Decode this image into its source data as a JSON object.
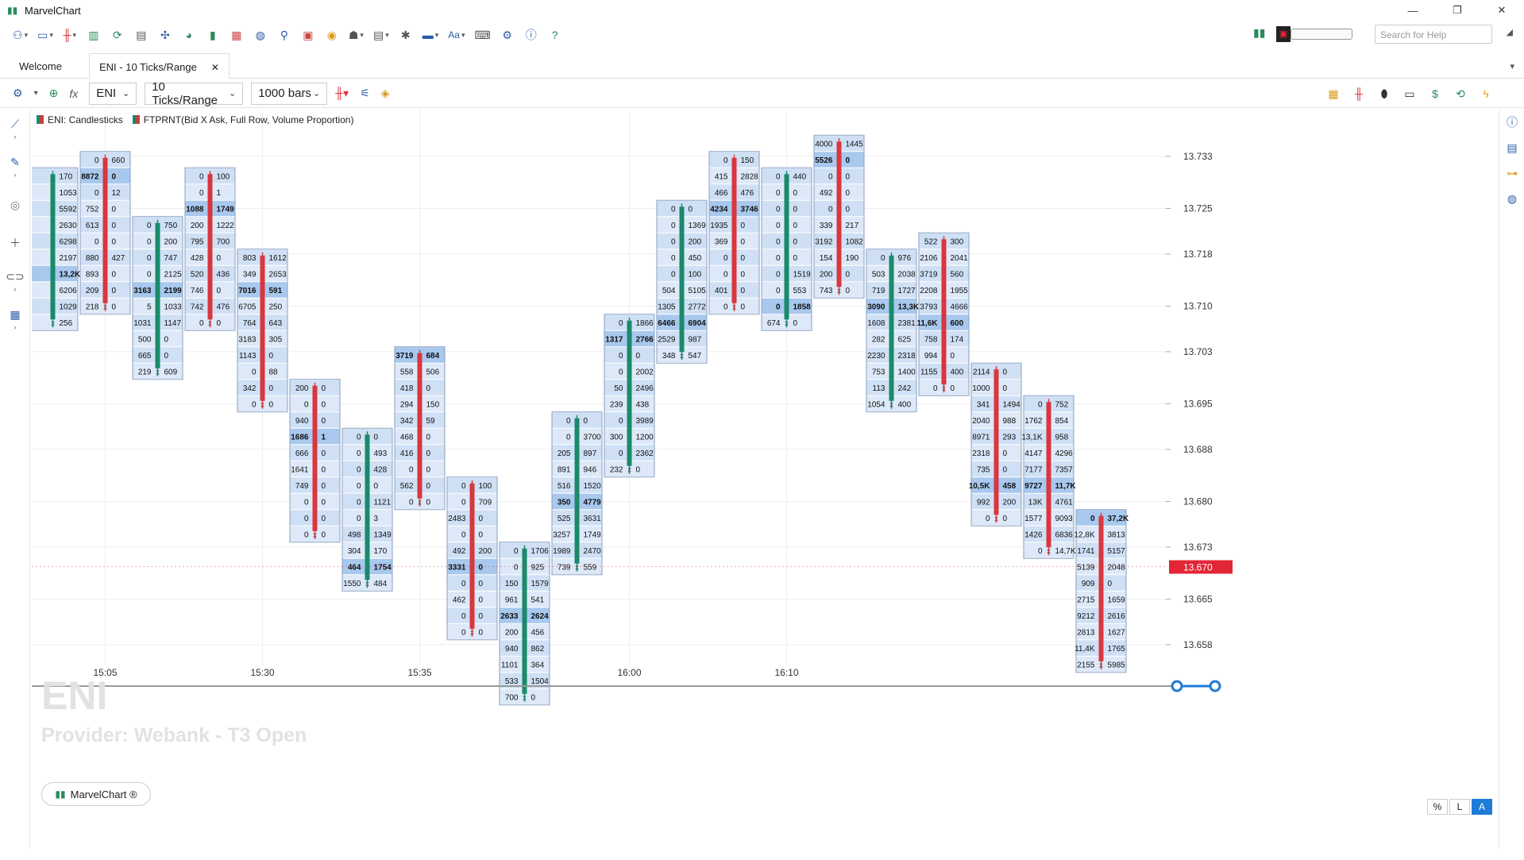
{
  "window": {
    "title": "MarvelChart",
    "buttons": [
      "—",
      "❐",
      "✕"
    ]
  },
  "toolbar": {
    "search_placeholder": "Search for Help"
  },
  "tabs": [
    {
      "label": "Welcome"
    },
    {
      "label": "ENI - 10 Ticks/Range",
      "close": "✕"
    }
  ],
  "chart_toolbar": {
    "symbol": "ENI",
    "timeframe": "10 Ticks/Range",
    "bars": "1000 bars"
  },
  "legend": {
    "series1": "ENI: Candlesticks",
    "series2": "FTPRNT(Bid X Ask, Full Row, Volume Proportion)"
  },
  "watermark": {
    "symbol": "ENI",
    "provider": "Provider: Webank - T3 Open"
  },
  "brand_button": "MarvelChart ®",
  "scale_buttons": [
    "%",
    "L",
    "A"
  ],
  "colors": {
    "bull": "#1a8a6a",
    "bear": "#d9363e",
    "cell": "#cfe0f5",
    "cell_alt": "#dde9f8",
    "poc": "#a8c8ee",
    "last": "#e32636"
  },
  "chart_data": {
    "type": "footprint",
    "symbol": "ENI",
    "tick_size": 0.0025,
    "price_axis": {
      "labels": [
        "13.733",
        "13.725",
        "13.718",
        "13.710",
        "13.703",
        "13.695",
        "13.688",
        "13.680",
        "13.673",
        "13.665",
        "13.658"
      ]
    },
    "last_price": "13.670",
    "time_labels": [
      "15:05",
      "15:30",
      "15:35",
      "16:00",
      "16:10"
    ],
    "bars": [
      {
        "dir": "bull",
        "top": 13.73,
        "rows": [
          [
            "",
            "170"
          ],
          [
            "",
            "1053"
          ],
          [
            "",
            "5592"
          ],
          [
            "",
            "2630"
          ],
          [
            "",
            "6298"
          ],
          [
            "",
            "2197"
          ],
          [
            "",
            "13,2K"
          ],
          [
            "",
            "6206"
          ],
          [
            "",
            "1029"
          ],
          [
            "",
            "256"
          ]
        ]
      },
      {
        "dir": "bear",
        "top": 13.7325,
        "rows": [
          [
            "0",
            "660"
          ],
          [
            "8872",
            "0"
          ],
          [
            "0",
            "12"
          ],
          [
            "752",
            "0"
          ],
          [
            "613",
            "0"
          ],
          [
            "0",
            "0"
          ],
          [
            "880",
            "427"
          ],
          [
            "893",
            "0"
          ],
          [
            "209",
            "0"
          ],
          [
            "218",
            "0"
          ]
        ]
      },
      {
        "dir": "bull",
        "top": 13.7225,
        "rows": [
          [
            "0",
            "750"
          ],
          [
            "0",
            "200"
          ],
          [
            "0",
            "747"
          ],
          [
            "0",
            "2125"
          ],
          [
            "3163",
            "2199"
          ],
          [
            "5",
            "1033"
          ],
          [
            "1031",
            "1147"
          ],
          [
            "500",
            "0"
          ],
          [
            "665",
            "0"
          ],
          [
            "219",
            "609"
          ]
        ]
      },
      {
        "dir": "bear",
        "top": 13.73,
        "rows": [
          [
            "0",
            "100"
          ],
          [
            "0",
            "1"
          ],
          [
            "1088",
            "1749"
          ],
          [
            "200",
            "1222"
          ],
          [
            "795",
            "700"
          ],
          [
            "428",
            "0"
          ],
          [
            "520",
            "436"
          ],
          [
            "746",
            "0"
          ],
          [
            "742",
            "476"
          ],
          [
            "0",
            "0"
          ]
        ]
      },
      {
        "dir": "bear",
        "top": 13.7175,
        "rows": [
          [
            "803",
            "1612"
          ],
          [
            "349",
            "2653"
          ],
          [
            "7016",
            "591"
          ],
          [
            "6705",
            "250"
          ],
          [
            "764",
            "643"
          ],
          [
            "3183",
            "305"
          ],
          [
            "1143",
            "0"
          ],
          [
            "0",
            "88"
          ],
          [
            "342",
            "0"
          ],
          [
            "0",
            "0"
          ]
        ]
      },
      {
        "dir": "bear",
        "top": 13.6975,
        "rows": [
          [
            "200",
            "0"
          ],
          [
            "0",
            "0"
          ],
          [
            "940",
            "0"
          ],
          [
            "1686",
            "1"
          ],
          [
            "666",
            "0"
          ],
          [
            "1641",
            "0"
          ],
          [
            "749",
            "0"
          ],
          [
            "0",
            "0"
          ],
          [
            "0",
            "0"
          ],
          [
            "0",
            "0"
          ]
        ]
      },
      {
        "dir": "bull",
        "top": 13.69,
        "rows": [
          [
            "0",
            "0"
          ],
          [
            "0",
            "493"
          ],
          [
            "0",
            "428"
          ],
          [
            "0",
            "0"
          ],
          [
            "0",
            "1121"
          ],
          [
            "0",
            "3"
          ],
          [
            "498",
            "1349"
          ],
          [
            "304",
            "170"
          ],
          [
            "464",
            "1754"
          ],
          [
            "1550",
            "484"
          ]
        ]
      },
      {
        "dir": "bear",
        "top": 13.7025,
        "rows": [
          [
            "3719",
            "684"
          ],
          [
            "558",
            "506"
          ],
          [
            "418",
            "0"
          ],
          [
            "294",
            "150"
          ],
          [
            "342",
            "59"
          ],
          [
            "468",
            "0"
          ],
          [
            "416",
            "0"
          ],
          [
            "0",
            "0"
          ],
          [
            "562",
            "0"
          ],
          [
            "0",
            "0"
          ]
        ]
      },
      {
        "dir": "bear",
        "top": 13.6825,
        "rows": [
          [
            "0",
            "100"
          ],
          [
            "0",
            "709"
          ],
          [
            "2483",
            "0"
          ],
          [
            "0",
            "0"
          ],
          [
            "492",
            "200"
          ],
          [
            "3331",
            "0"
          ],
          [
            "0",
            "0"
          ],
          [
            "462",
            "0"
          ],
          [
            "0",
            "0"
          ],
          [
            "0",
            "0"
          ]
        ]
      },
      {
        "dir": "bull",
        "top": 13.6725,
        "rows": [
          [
            "0",
            "1706"
          ],
          [
            "0",
            "925"
          ],
          [
            "150",
            "1579"
          ],
          [
            "961",
            "541"
          ],
          [
            "2633",
            "2624"
          ],
          [
            "200",
            "456"
          ],
          [
            "940",
            "862"
          ],
          [
            "1101",
            "364"
          ],
          [
            "533",
            "1504"
          ],
          [
            "700",
            "0"
          ]
        ]
      },
      {
        "dir": "bull",
        "top": 13.6925,
        "rows": [
          [
            "0",
            "0"
          ],
          [
            "0",
            "3700"
          ],
          [
            "205",
            "897"
          ],
          [
            "891",
            "946"
          ],
          [
            "516",
            "1520"
          ],
          [
            "350",
            "4779"
          ],
          [
            "525",
            "3631"
          ],
          [
            "3257",
            "1749"
          ],
          [
            "1989",
            "2470"
          ],
          [
            "739",
            "559"
          ]
        ]
      },
      {
        "dir": "bull",
        "top": 13.7075,
        "rows": [
          [
            "0",
            "1866"
          ],
          [
            "1317",
            "2766"
          ],
          [
            "0",
            "0"
          ],
          [
            "0",
            "2002"
          ],
          [
            "50",
            "2496"
          ],
          [
            "239",
            "438"
          ],
          [
            "0",
            "3989"
          ],
          [
            "300",
            "1200"
          ],
          [
            "0",
            "2362"
          ],
          [
            "232",
            "0"
          ]
        ]
      },
      {
        "dir": "bull",
        "top": 13.725,
        "rows": [
          [
            "0",
            "0"
          ],
          [
            "0",
            "1369"
          ],
          [
            "0",
            "200"
          ],
          [
            "0",
            "450"
          ],
          [
            "0",
            "100"
          ],
          [
            "504",
            "5105"
          ],
          [
            "1305",
            "2772"
          ],
          [
            "6466",
            "6904"
          ],
          [
            "2529",
            "987"
          ],
          [
            "348",
            "547"
          ]
        ]
      },
      {
        "dir": "bear",
        "top": 13.7325,
        "rows": [
          [
            "0",
            "150"
          ],
          [
            "415",
            "2828"
          ],
          [
            "466",
            "476"
          ],
          [
            "4234",
            "3746"
          ],
          [
            "1935",
            "0"
          ],
          [
            "369",
            "0"
          ],
          [
            "0",
            "0"
          ],
          [
            "0",
            "0"
          ],
          [
            "401",
            "0"
          ],
          [
            "0",
            "0"
          ]
        ]
      },
      {
        "dir": "bull",
        "top": 13.73,
        "rows": [
          [
            "0",
            "440"
          ],
          [
            "0",
            "0"
          ],
          [
            "0",
            "0"
          ],
          [
            "0",
            "0"
          ],
          [
            "0",
            "0"
          ],
          [
            "0",
            "0"
          ],
          [
            "0",
            "1519"
          ],
          [
            "0",
            "553"
          ],
          [
            "0",
            "1858"
          ],
          [
            "674",
            "0"
          ]
        ]
      },
      {
        "dir": "bear",
        "top": 13.735,
        "rows": [
          [
            "4000",
            "1445"
          ],
          [
            "5526",
            "0"
          ],
          [
            "0",
            "0"
          ],
          [
            "492",
            "0"
          ],
          [
            "0",
            "0"
          ],
          [
            "339",
            "217"
          ],
          [
            "3192",
            "1082"
          ],
          [
            "154",
            "190"
          ],
          [
            "200",
            "0"
          ],
          [
            "743",
            "0"
          ]
        ]
      },
      {
        "dir": "bull",
        "top": 13.7175,
        "rows": [
          [
            "0",
            "976"
          ],
          [
            "503",
            "2038"
          ],
          [
            "719",
            "1727"
          ],
          [
            "3090",
            "13,3K"
          ],
          [
            "1608",
            "2381"
          ],
          [
            "282",
            "625"
          ],
          [
            "2230",
            "2318"
          ],
          [
            "753",
            "1400"
          ],
          [
            "113",
            "242"
          ],
          [
            "1054",
            "400"
          ]
        ]
      },
      {
        "dir": "bear",
        "top": 13.72,
        "rows": [
          [
            "522",
            "300"
          ],
          [
            "2106",
            "2041"
          ],
          [
            "3719",
            "560"
          ],
          [
            "2208",
            "1955"
          ],
          [
            "3793",
            "4666"
          ],
          [
            "11,6K",
            "600"
          ],
          [
            "758",
            "174"
          ],
          [
            "994",
            "0"
          ],
          [
            "1155",
            "400"
          ],
          [
            "0",
            "0"
          ]
        ]
      },
      {
        "dir": "bear",
        "top": 13.7,
        "rows": [
          [
            "2114",
            "0"
          ],
          [
            "1000",
            "0"
          ],
          [
            "341",
            "1494"
          ],
          [
            "2040",
            "988"
          ],
          [
            "8971",
            "293"
          ],
          [
            "2318",
            "0"
          ],
          [
            "735",
            "0"
          ],
          [
            "10,5K",
            "458"
          ],
          [
            "992",
            "200"
          ],
          [
            "0",
            "0"
          ]
        ]
      },
      {
        "dir": "bear",
        "top": 13.695,
        "rows": [
          [
            "0",
            "752"
          ],
          [
            "1762",
            "854"
          ],
          [
            "13,1K",
            "958"
          ],
          [
            "4147",
            "4296"
          ],
          [
            "7177",
            "7357"
          ],
          [
            "9727",
            "11,7K"
          ],
          [
            "13K",
            "4761"
          ],
          [
            "1577",
            "9093"
          ],
          [
            "1426",
            "6836"
          ],
          [
            "0",
            "14,7K"
          ]
        ]
      },
      {
        "dir": "bear",
        "top": 13.6775,
        "rows": [
          [
            "0",
            "37,2K"
          ],
          [
            "12,8K",
            "3813"
          ],
          [
            "1741",
            "5157"
          ],
          [
            "5139",
            "2048"
          ],
          [
            "909",
            "0"
          ],
          [
            "2715",
            "1659"
          ],
          [
            "9212",
            "2616"
          ],
          [
            "2813",
            "1627"
          ],
          [
            "11,4K",
            "1765"
          ],
          [
            "2155",
            "5985"
          ]
        ]
      }
    ]
  }
}
